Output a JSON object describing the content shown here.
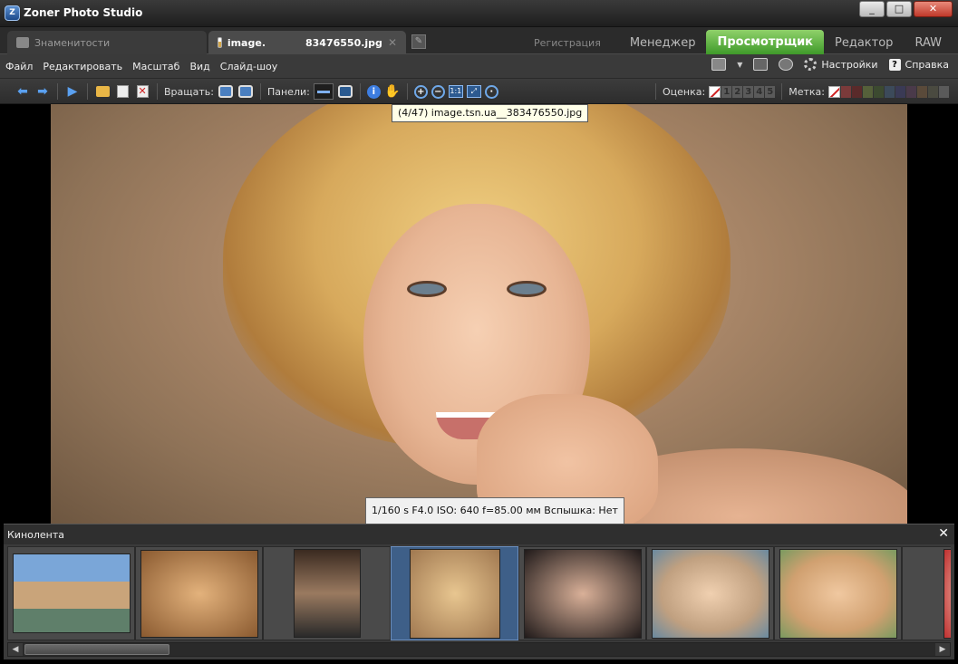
{
  "window": {
    "title": "Zoner Photo Studio",
    "buttons": [
      "_",
      "□",
      "✕"
    ]
  },
  "tabs": {
    "inactive": {
      "label": "Знаменитости"
    },
    "active": {
      "label_left": "image.",
      "label_right": "83476550.jpg",
      "close": "✕"
    },
    "new_tab": "✎"
  },
  "modes": {
    "registration": "Регистрация",
    "manager": "Менеджер",
    "viewer": "Просмотрщик",
    "editor": "Редактор",
    "raw": "RAW"
  },
  "menu": {
    "items": [
      "Файл",
      "Редактировать",
      "Масштаб",
      "Вид",
      "Слайд-шоу"
    ],
    "settings": "Настройки",
    "help": "Справка"
  },
  "toolbar": {
    "rotate_label": "Вращать:",
    "panels_label": "Панели:",
    "rating_label": "Оценка:",
    "rating_values": [
      "1",
      "2",
      "3",
      "4",
      "5"
    ],
    "label_label": "Метка:",
    "label_colors": [
      "#7a3a3a",
      "#5a2a2a",
      "#55603a",
      "#3c4a30",
      "#3c4a5a",
      "#3a3a55",
      "#4a3a4a",
      "#5a4a3a",
      "#4a4a40",
      "#5a5a5a"
    ],
    "zoom_1_1": "1:1"
  },
  "tooltip": "(4/47) image.tsn.ua__383476550.jpg",
  "exif": "1/160 s F4.0 ISO: 640 f=85.00 мм Вспышка: Нет",
  "filmstrip": {
    "title": "Кинолента",
    "close": "✕",
    "thumbs": [
      {
        "bg": "linear-gradient(#7aa6d8 0 35%, #c9a47a 35% 70%, #5f7f6a 70%)",
        "w": 130,
        "h": 88
      },
      {
        "bg": "radial-gradient(#e3b27c, #8a5a30)",
        "w": 130,
        "h": 97
      },
      {
        "bg": "linear-gradient(#3a2a20, #9a7a60 50%, #2a2a2a)",
        "w": 74,
        "h": 98
      },
      {
        "bg": "radial-gradient(#e8c690, #a07850)",
        "w": 100,
        "h": 99
      },
      {
        "bg": "radial-gradient(#d9b098, #201a1a)",
        "w": 130,
        "h": 99
      },
      {
        "bg": "radial-gradient(#f0d0b0, #c0a080 60%, #6a8aa0)",
        "w": 130,
        "h": 99
      },
      {
        "bg": "radial-gradient(#f0c8a0, #d0a070 60%, #7a9a60)",
        "w": 130,
        "h": 99
      },
      {
        "bg": "radial-gradient(#f0c0b0, #c03030)",
        "w": 50,
        "h": 99
      }
    ]
  }
}
